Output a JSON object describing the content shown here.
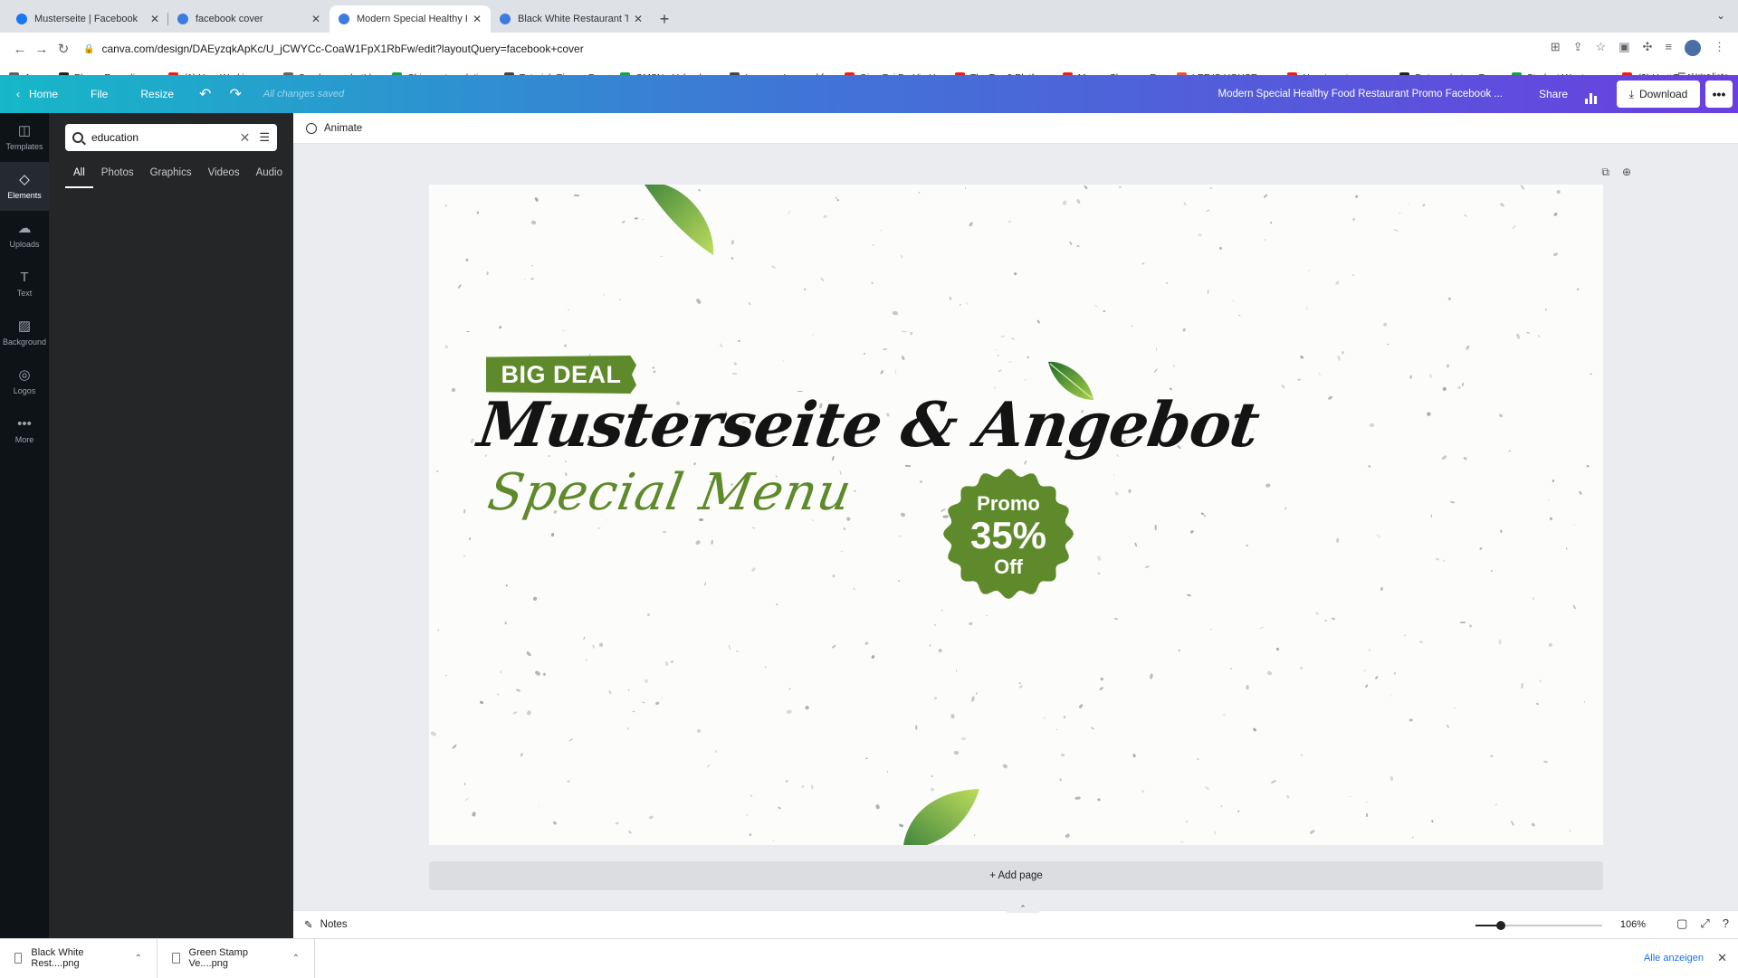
{
  "browser": {
    "tabs": [
      {
        "title": "Musterseite | Facebook",
        "favicon_color": "#1877f2",
        "active": false
      },
      {
        "title": "facebook cover",
        "favicon_color": "#3c7be0",
        "active": false
      },
      {
        "title": "Modern Special Healthy Food R",
        "favicon_color": "#3c7be0",
        "active": true
      },
      {
        "title": "Black White Restaurant Typogr",
        "favicon_color": "#3c7be0",
        "active": false
      }
    ],
    "new_tab": "+",
    "url": "canva.com/design/DAEyzqkApKc/U_jCWYCc-CoaW1FpX1RbFw/edit?layoutQuery=facebook+cover",
    "bookmarks": [
      {
        "label": "Apps",
        "color": "#5f6368"
      },
      {
        "label": "Phone Recycling,...",
        "color": "#222222"
      },
      {
        "label": "(1) How Working a...",
        "color": "#e62117"
      },
      {
        "label": "Sonderangebot! |...",
        "color": "#666666"
      },
      {
        "label": "Chinese translatio...",
        "color": "#1a9e4b"
      },
      {
        "label": "Tutorial: Eigene Fa...",
        "color": "#444444"
      },
      {
        "label": "GMSN - Vologda,...",
        "color": "#1a9e4b"
      },
      {
        "label": "Lessons Learned f...",
        "color": "#444444"
      },
      {
        "label": "Qing Fei De Yi - Y...",
        "color": "#e62117"
      },
      {
        "label": "The Top 3 Platfor...",
        "color": "#e62117"
      },
      {
        "label": "Money Changes E...",
        "color": "#e62117"
      },
      {
        "label": "LEE 'S HOUSE—...",
        "color": "#e8553b"
      },
      {
        "label": "How to get more v...",
        "color": "#e62117"
      },
      {
        "label": "Datenschutz – Re...",
        "color": "#222222"
      },
      {
        "label": "Student Wants an...",
        "color": "#1a9e4b"
      },
      {
        "label": "(2) How To Add A...",
        "color": "#e62117"
      }
    ],
    "bookmarks_more": "»",
    "reading_list": "Leseliste"
  },
  "canva_bar": {
    "home": "Home",
    "file": "File",
    "resize": "Resize",
    "saved_status": "All changes saved",
    "doc_title": "Modern Special Healthy Food Restaurant Promo Facebook ...",
    "share": "Share",
    "download": "Download",
    "more": "•••"
  },
  "rail": [
    {
      "label": "Templates",
      "icon": "◫",
      "active": false
    },
    {
      "label": "Elements",
      "icon": "◇",
      "active": true
    },
    {
      "label": "Uploads",
      "icon": "☁",
      "active": false
    },
    {
      "label": "Text",
      "icon": "T",
      "active": false
    },
    {
      "label": "Background",
      "icon": "▨",
      "active": false
    },
    {
      "label": "Logos",
      "icon": "◎",
      "active": false
    },
    {
      "label": "More",
      "icon": "•••",
      "active": false
    }
  ],
  "panel": {
    "search_value": "education",
    "tabs": [
      "All",
      "Photos",
      "Graphics",
      "Videos",
      "Audio"
    ],
    "active_tab": "All"
  },
  "workspace": {
    "animate": "Animate",
    "add_page": "+ Add page",
    "notes": "Notes",
    "zoom": "106%",
    "zoom_level": 0.2
  },
  "design": {
    "tag": "BIG DEAL",
    "headline": "Musterseite & Angebot",
    "subline": "Special Menu",
    "badge_line1": "Promo",
    "badge_line2": "35%",
    "badge_line3": "Off",
    "accent_color": "#5f8a2b"
  },
  "downloads": [
    {
      "name": "Black White Rest....png"
    },
    {
      "name": "Green Stamp Ve....png"
    }
  ],
  "downloads_show_all": "Alle anzeigen"
}
